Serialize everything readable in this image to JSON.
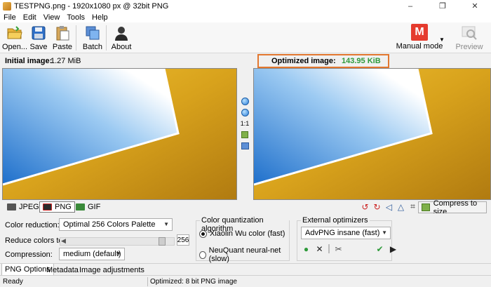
{
  "window": {
    "title": "TESTPNG.png - 1920x1080 px @ 32bit PNG",
    "minimize": "–",
    "maximize": "❐",
    "close": "✕"
  },
  "menu": [
    "File",
    "Edit",
    "View",
    "Tools",
    "Help"
  ],
  "toolbar": {
    "open": "Open...",
    "save": "Save",
    "paste": "Paste",
    "batch": "Batch",
    "about": "About",
    "manual_mode": "Manual mode",
    "manual_icon_letter": "M",
    "preview": "Preview"
  },
  "info": {
    "initial_label": "Initial image:",
    "initial_value": "1.27 MiB",
    "optimized_label": "Optimized image:",
    "optimized_value": "143.95 KiB"
  },
  "zoom_tools": {
    "one_to_one": "1:1"
  },
  "formats": {
    "jpeg": "JPEG",
    "png": "PNG",
    "gif": "GIF",
    "compress_button": "Compress to size"
  },
  "options": {
    "color_reduction_label": "Color reduction:",
    "color_reduction_value": "Optimal 256 Colors Palette",
    "reduce_colors_label": "Reduce colors to:",
    "reduce_colors_value": "256",
    "compression_label": "Compression:",
    "compression_value": "medium (default)",
    "quant_group_title": "Color quantization algorithm",
    "quant_option_1": "Xiaolin Wu color (fast)",
    "quant_option_2": "NeuQuant neural-net (slow)",
    "ext_group_title": "External optimizers",
    "ext_value": "AdvPNG insane (fast)"
  },
  "bottom_tabs": [
    "PNG Options",
    "Metadata",
    "Image adjustments"
  ],
  "status": {
    "left": "Ready",
    "middle": "Optimized: 8 bit PNG image"
  },
  "colors": {
    "accent_orange": "#e2772f",
    "optimized_green": "#2e9a3a",
    "manual_red": "#e53b2e"
  }
}
